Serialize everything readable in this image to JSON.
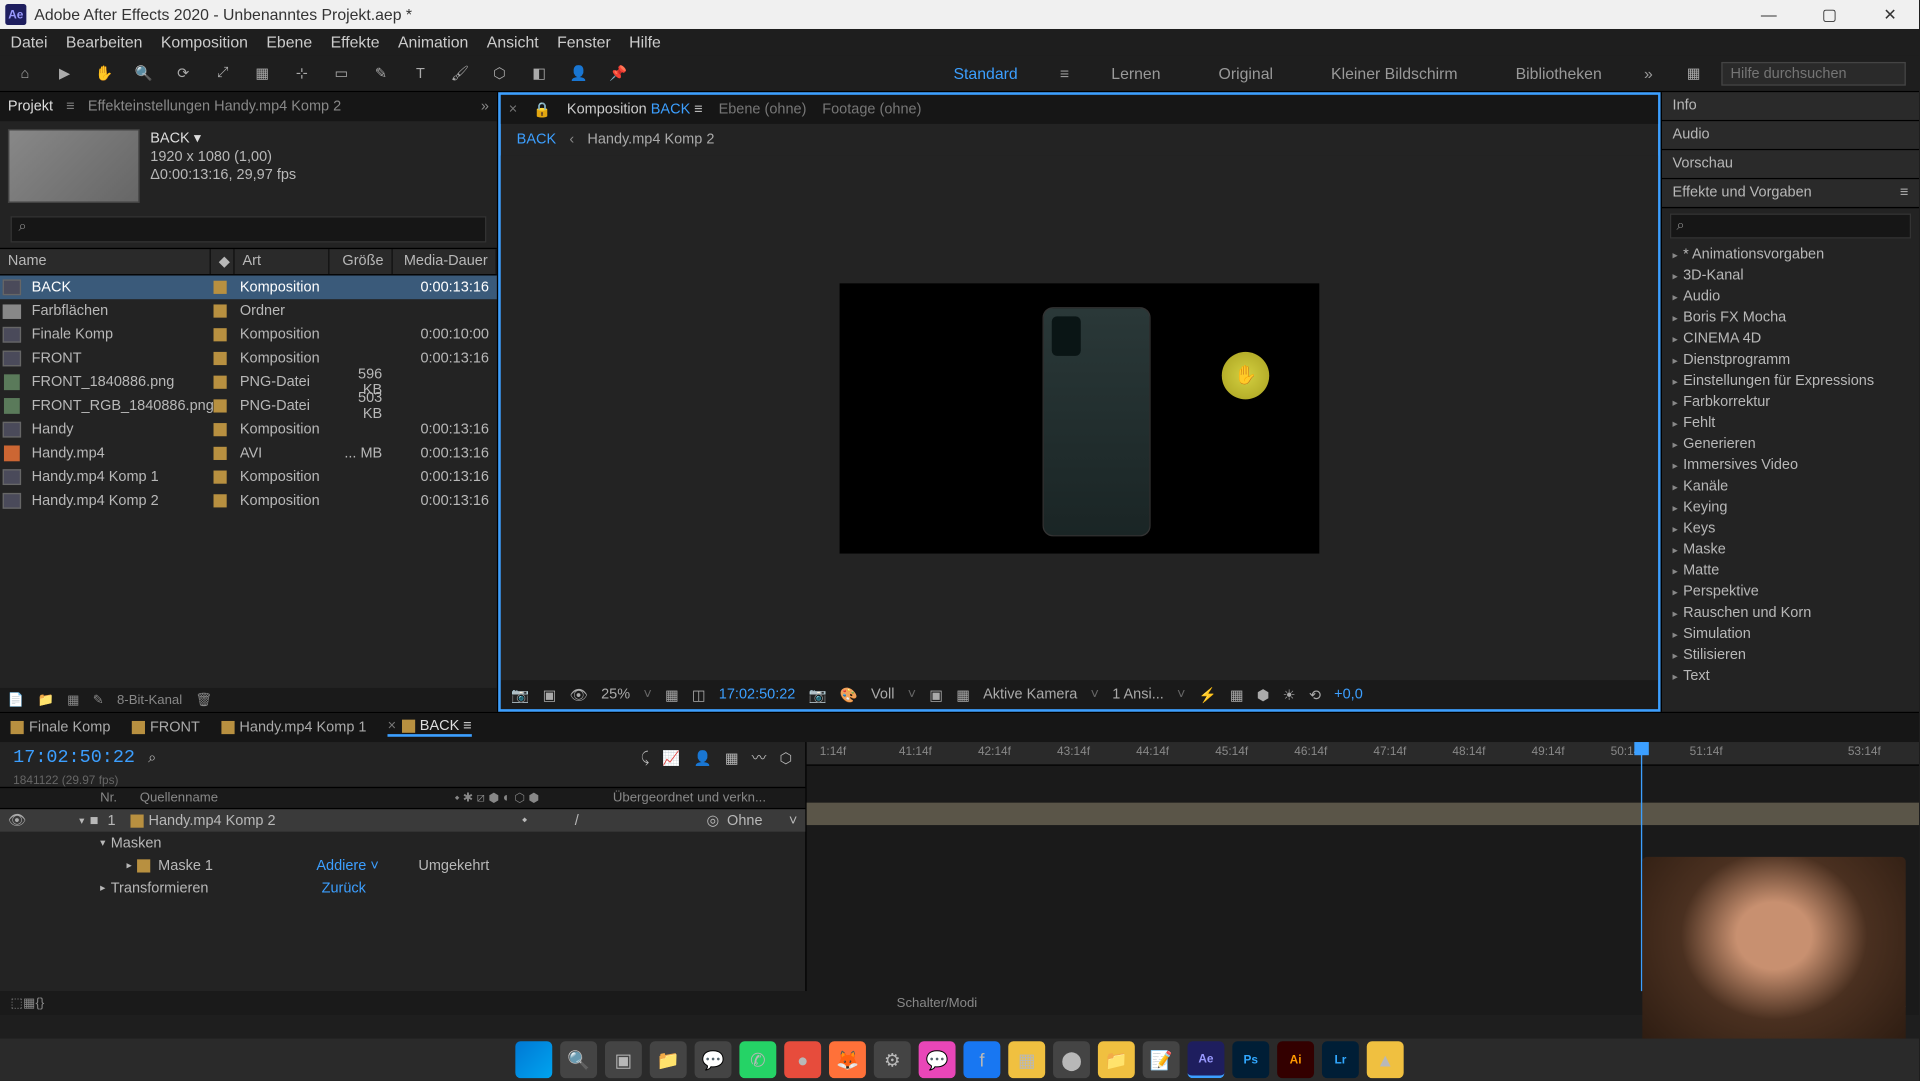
{
  "window": {
    "title": "Adobe After Effects 2020 - Unbenanntes Projekt.aep *"
  },
  "menu": [
    "Datei",
    "Bearbeiten",
    "Komposition",
    "Ebene",
    "Effekte",
    "Animation",
    "Ansicht",
    "Fenster",
    "Hilfe"
  ],
  "workspaces": {
    "active": "Standard",
    "others": [
      "Lernen",
      "Original",
      "Kleiner Bildschirm",
      "Bibliotheken"
    ],
    "search_placeholder": "Hilfe durchsuchen"
  },
  "project_panel": {
    "tab_project": "Projekt",
    "tab_effects": "Effekteinstellungen  Handy.mp4 Komp 2",
    "comp_name": "BACK ▾",
    "comp_res": "1920 x 1080 (1,00)",
    "comp_dur": "Δ0:00:13:16, 29,97 fps",
    "cols": {
      "name": "Name",
      "art": "Art",
      "size": "Größe",
      "dur": "Media-Dauer"
    },
    "items": [
      {
        "name": "BACK",
        "type": "Komposition",
        "size": "",
        "dur": "0:00:13:16",
        "icon": "comp",
        "sel": true
      },
      {
        "name": "Farbflächen",
        "type": "Ordner",
        "size": "",
        "dur": "",
        "icon": "folder"
      },
      {
        "name": "Finale Komp",
        "type": "Komposition",
        "size": "",
        "dur": "0:00:10:00",
        "icon": "comp"
      },
      {
        "name": "FRONT",
        "type": "Komposition",
        "size": "",
        "dur": "0:00:13:16",
        "icon": "comp"
      },
      {
        "name": "FRONT_1840886.png",
        "type": "PNG-Datei",
        "size": "596 KB",
        "dur": "",
        "icon": "img"
      },
      {
        "name": "FRONT_RGB_1840886.png",
        "type": "PNG-Datei",
        "size": "503 KB",
        "dur": "",
        "icon": "img"
      },
      {
        "name": "Handy",
        "type": "Komposition",
        "size": "",
        "dur": "0:00:13:16",
        "icon": "comp"
      },
      {
        "name": "Handy.mp4",
        "type": "AVI",
        "size": "... MB",
        "dur": "0:00:13:16",
        "icon": "video"
      },
      {
        "name": "Handy.mp4 Komp 1",
        "type": "Komposition",
        "size": "",
        "dur": "0:00:13:16",
        "icon": "comp"
      },
      {
        "name": "Handy.mp4 Komp 2",
        "type": "Komposition",
        "size": "",
        "dur": "0:00:13:16",
        "icon": "comp"
      }
    ],
    "footer_depth": "8-Bit-Kanal"
  },
  "comp_panel": {
    "tab_label": "Komposition",
    "tab_active": "BACK",
    "tab_ebene": "Ebene  (ohne)",
    "tab_footage": "Footage  (ohne)",
    "bc_back": "BACK",
    "bc_comp": "Handy.mp4 Komp 2",
    "viewer_bar": {
      "zoom": "25%",
      "tc": "17:02:50:22",
      "res": "Voll",
      "camera": "Aktive Kamera",
      "views": "1 Ansi...",
      "exposure": "+0,0"
    }
  },
  "right_panel": {
    "info": "Info",
    "audio": "Audio",
    "preview": "Vorschau",
    "effects_title": "Effekte und Vorgaben",
    "effects": [
      "* Animationsvorgaben",
      "3D-Kanal",
      "Audio",
      "Boris FX Mocha",
      "CINEMA 4D",
      "Dienstprogramm",
      "Einstellungen für Expressions",
      "Farbkorrektur",
      "Fehlt",
      "Generieren",
      "Immersives Video",
      "Kanäle",
      "Keying",
      "Keys",
      "Maske",
      "Matte",
      "Perspektive",
      "Rauschen und Korn",
      "Simulation",
      "Stilisieren",
      "Text"
    ]
  },
  "timeline": {
    "tabs": [
      "Finale Komp",
      "FRONT",
      "Handy.mp4 Komp 1",
      "BACK"
    ],
    "active_tab": 3,
    "tc": "17:02:50:22",
    "tc_sub": "1841122 (29.97 fps)",
    "col_nr": "Nr.",
    "col_name": "Quellenname",
    "col_parent": "Übergeordnet und verkn...",
    "layer": {
      "num": "1",
      "name": "Handy.mp4 Komp 2",
      "parent": "Ohne",
      "masks": "Masken",
      "mask1": "Maske 1",
      "mask_mode": "Addiere ˅",
      "mask_invert": "Umgekehrt",
      "transform": "Transformieren",
      "reset": "Zurück"
    },
    "ruler": [
      "1:14f",
      "41:14f",
      "42:14f",
      "43:14f",
      "44:14f",
      "45:14f",
      "46:14f",
      "47:14f",
      "48:14f",
      "49:14f",
      "50:14f",
      "51:14f",
      "",
      "53:14f"
    ],
    "footer": "Schalter/Modi"
  }
}
